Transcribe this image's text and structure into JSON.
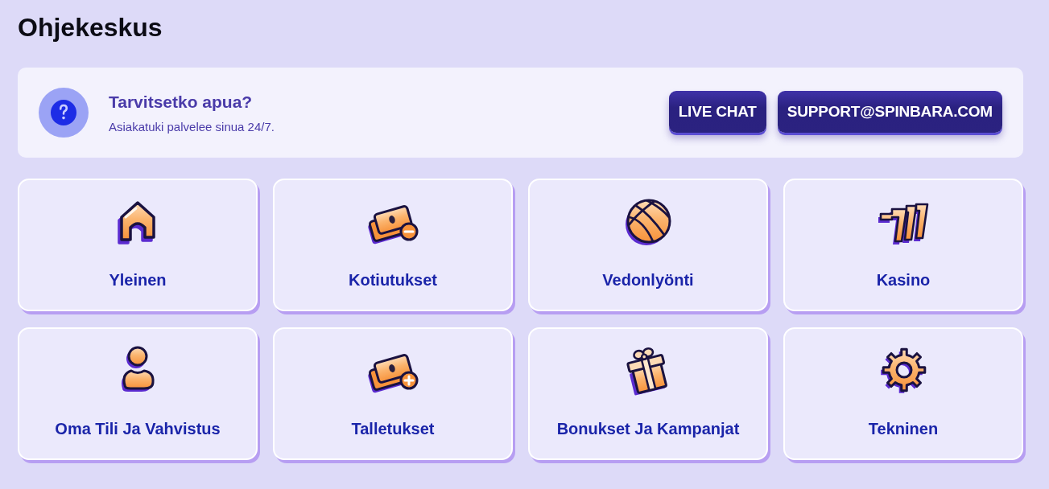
{
  "page": {
    "title": "Ohjekeskus"
  },
  "help_banner": {
    "title": "Tarvitsetko apua?",
    "subtitle": "Asiakatuki palvelee sinua 24/7.",
    "buttons": [
      "LIVE CHAT",
      "SUPPORT@SPINBARA.COM"
    ]
  },
  "categories": [
    {
      "label": "Yleinen",
      "kind": "house"
    },
    {
      "label": "Kotiutukset",
      "kind": "withdraw"
    },
    {
      "label": "Vedonlyönti",
      "kind": "ball"
    },
    {
      "label": "Kasino",
      "kind": "sevens"
    },
    {
      "label": "Oma Tili Ja Vahvistus",
      "kind": "user"
    },
    {
      "label": "Talletukset",
      "kind": "deposit"
    },
    {
      "label": "Bonukset Ja Kampanjat",
      "kind": "gift"
    },
    {
      "label": "Tekninen",
      "kind": "gear"
    }
  ]
}
